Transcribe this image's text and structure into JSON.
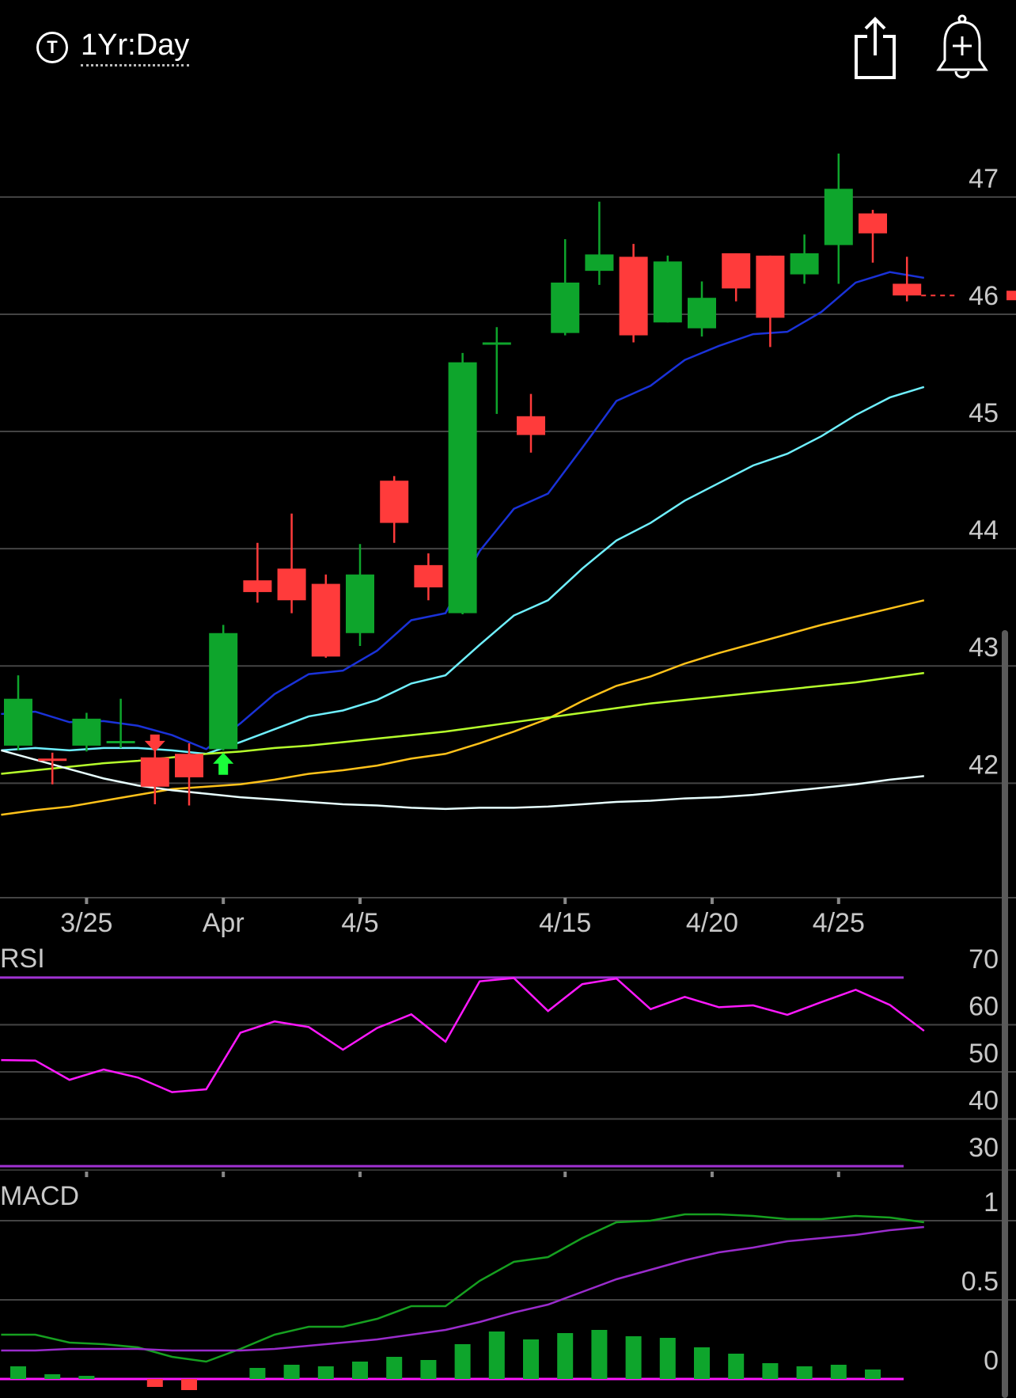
{
  "header": {
    "timeframe_icon": "T",
    "timeframe_label": "1Yr:Day",
    "share_icon": "share-icon",
    "alert_icon": "add-alert-bell-icon"
  },
  "colors": {
    "up": "#0ea52c",
    "down": "#ff3b3b",
    "ema_blue": "#1a32d8",
    "ema_cyan": "#6ff0ff",
    "ma_orange": "#ffc21a",
    "ma_lime": "#b6ff2c",
    "ma_white": "#e8ffff",
    "rsi_line": "#ff19ff",
    "rsi_band": "#a032d2",
    "macd_line": "#16a020",
    "signal_line": "#9a2ccc",
    "hist_pos": "#0ea52c",
    "hist_neg": "#ff3b3b",
    "grid": "#444444",
    "text": "#c8c8c8"
  },
  "chart_data": [
    {
      "type": "candlestick",
      "panel": "price",
      "x_labels": [
        {
          "label": "3/25",
          "index": 2
        },
        {
          "label": "Apr",
          "index": 6
        },
        {
          "label": "4/5",
          "index": 10
        },
        {
          "label": "4/15",
          "index": 16
        },
        {
          "label": "4/20",
          "index": 20.3
        },
        {
          "label": "4/25",
          "index": 24
        }
      ],
      "y_ticks": [
        42,
        43,
        44,
        45,
        46,
        47
      ],
      "ylim": [
        41.05,
        47.6
      ],
      "candles": [
        {
          "o": 42.32,
          "h": 42.92,
          "l": 42.28,
          "c": 42.72
        },
        {
          "o": 42.2,
          "h": 42.26,
          "l": 41.99,
          "c": 42.18
        },
        {
          "o": 42.32,
          "h": 42.6,
          "l": 42.27,
          "c": 42.55
        },
        {
          "o": 42.35,
          "h": 42.72,
          "l": 42.3,
          "c": 42.35
        },
        {
          "o": 42.22,
          "h": 42.38,
          "l": 41.82,
          "c": 41.97
        },
        {
          "o": 42.25,
          "h": 42.34,
          "l": 41.81,
          "c": 42.05
        },
        {
          "o": 42.29,
          "h": 43.35,
          "l": 42.28,
          "c": 43.28
        },
        {
          "o": 43.73,
          "h": 44.05,
          "l": 43.54,
          "c": 43.63
        },
        {
          "o": 43.83,
          "h": 44.3,
          "l": 43.45,
          "c": 43.56
        },
        {
          "o": 43.7,
          "h": 43.78,
          "l": 43.07,
          "c": 43.08
        },
        {
          "o": 43.28,
          "h": 44.04,
          "l": 43.17,
          "c": 43.78
        },
        {
          "o": 44.58,
          "h": 44.62,
          "l": 44.05,
          "c": 44.22
        },
        {
          "o": 43.86,
          "h": 43.96,
          "l": 43.56,
          "c": 43.67
        },
        {
          "o": 43.45,
          "h": 45.67,
          "l": 43.44,
          "c": 45.59
        },
        {
          "o": 45.75,
          "h": 45.89,
          "l": 45.15,
          "c": 45.75
        },
        {
          "o": 45.13,
          "h": 45.32,
          "l": 44.82,
          "c": 44.97
        },
        {
          "o": 45.84,
          "h": 46.64,
          "l": 45.82,
          "c": 46.27
        },
        {
          "o": 46.37,
          "h": 46.96,
          "l": 46.25,
          "c": 46.51
        },
        {
          "o": 46.49,
          "h": 46.6,
          "l": 45.76,
          "c": 45.82
        },
        {
          "o": 45.93,
          "h": 46.5,
          "l": 45.93,
          "c": 46.45
        },
        {
          "o": 45.88,
          "h": 46.28,
          "l": 45.81,
          "c": 46.14
        },
        {
          "o": 46.52,
          "h": 46.52,
          "l": 46.11,
          "c": 46.22
        },
        {
          "o": 46.5,
          "h": 46.5,
          "l": 45.72,
          "c": 45.97
        },
        {
          "o": 46.34,
          "h": 46.68,
          "l": 46.26,
          "c": 46.52
        },
        {
          "o": 46.59,
          "h": 47.37,
          "l": 46.26,
          "c": 47.07
        },
        {
          "o": 46.86,
          "h": 46.89,
          "l": 46.44,
          "c": 46.69
        },
        {
          "o": 46.26,
          "h": 46.49,
          "l": 46.11,
          "c": 46.16
        }
      ],
      "last_price": 46.16,
      "signals": [
        {
          "type": "sell",
          "index": 4,
          "y": 42.28
        },
        {
          "type": "buy",
          "index": 6,
          "y": 42.26
        }
      ],
      "overlays": [
        {
          "key": "ema_blue",
          "start": 0,
          "values": [
            42.59,
            42.61,
            42.52,
            42.53,
            42.49,
            42.41,
            42.29,
            42.51,
            42.76,
            42.93,
            42.96,
            43.13,
            43.39,
            43.45,
            43.98,
            44.34,
            44.47,
            44.86,
            45.26,
            45.39,
            45.61,
            45.73,
            45.83,
            45.85,
            46.02,
            46.27,
            46.36,
            46.31
          ]
        },
        {
          "key": "ema_cyan",
          "start": 0,
          "values": [
            42.28,
            42.3,
            42.28,
            42.3,
            42.3,
            42.28,
            42.25,
            42.35,
            42.46,
            42.57,
            42.62,
            42.71,
            42.85,
            42.92,
            43.18,
            43.43,
            43.56,
            43.83,
            44.07,
            44.22,
            44.41,
            44.56,
            44.71,
            44.81,
            44.96,
            45.14,
            45.29,
            45.38
          ]
        },
        {
          "key": "ma_orange",
          "start": 0,
          "values": [
            41.73,
            41.77,
            41.8,
            41.85,
            41.9,
            41.95,
            41.97,
            41.99,
            42.03,
            42.08,
            42.11,
            42.15,
            42.21,
            42.25,
            42.34,
            42.44,
            42.55,
            42.7,
            42.83,
            42.91,
            43.02,
            43.11,
            43.19,
            43.27,
            43.35,
            43.42,
            43.49,
            43.56
          ]
        },
        {
          "key": "ma_lime",
          "start": 0,
          "values": [
            42.08,
            42.11,
            42.14,
            42.17,
            42.19,
            42.22,
            42.25,
            42.27,
            42.3,
            42.32,
            42.35,
            42.38,
            42.41,
            42.44,
            42.48,
            42.52,
            42.56,
            42.6,
            42.64,
            42.68,
            42.71,
            42.74,
            42.77,
            42.8,
            42.83,
            42.86,
            42.9,
            42.94
          ]
        },
        {
          "key": "ma_white",
          "start": 0,
          "values": [
            42.28,
            42.2,
            42.12,
            42.04,
            41.98,
            41.94,
            41.91,
            41.88,
            41.86,
            41.84,
            41.82,
            41.81,
            41.79,
            41.78,
            41.79,
            41.79,
            41.8,
            41.82,
            41.84,
            41.85,
            41.87,
            41.88,
            41.9,
            41.93,
            41.96,
            41.99,
            42.03,
            42.06
          ]
        }
      ]
    },
    {
      "type": "line",
      "panel": "rsi",
      "title": "RSI",
      "y_ticks": [
        30,
        40,
        50,
        60,
        70
      ],
      "ylim": [
        27.5,
        72.5
      ],
      "bands": [
        30,
        70
      ],
      "series": [
        {
          "key": "rsi_line",
          "start": -0.5,
          "values": [
            52.5,
            52.4,
            48.3,
            50.5,
            48.8,
            45.7,
            46.3,
            58.3,
            60.7,
            59.5,
            54.7,
            59.3,
            62.2,
            56.4,
            69.2,
            69.9,
            62.9,
            68.6,
            69.8,
            63.3,
            65.9,
            63.7,
            64.1,
            62.1,
            64.8,
            67.4,
            64.2,
            58.7
          ]
        }
      ]
    },
    {
      "type": "line",
      "panel": "macd",
      "title": "MACD",
      "y_ticks": [
        0,
        0.5,
        1
      ],
      "ylim": [
        -0.12,
        1.24
      ],
      "series": [
        {
          "key": "macd_line",
          "start": -0.5,
          "values": [
            0.28,
            0.28,
            0.23,
            0.22,
            0.2,
            0.14,
            0.11,
            0.19,
            0.28,
            0.33,
            0.33,
            0.38,
            0.46,
            0.46,
            0.62,
            0.74,
            0.77,
            0.89,
            0.99,
            1.0,
            1.04,
            1.04,
            1.03,
            1.01,
            1.01,
            1.03,
            1.02,
            0.99
          ]
        },
        {
          "key": "signal_line",
          "start": -0.5,
          "values": [
            0.18,
            0.18,
            0.19,
            0.19,
            0.19,
            0.18,
            0.18,
            0.18,
            0.19,
            0.21,
            0.23,
            0.25,
            0.28,
            0.31,
            0.36,
            0.42,
            0.47,
            0.55,
            0.63,
            0.69,
            0.75,
            0.8,
            0.83,
            0.87,
            0.89,
            0.91,
            0.94,
            0.96
          ]
        }
      ],
      "histogram": [
        0.08,
        0.03,
        0.02,
        0,
        -0.05,
        -0.07,
        0,
        0.07,
        0.09,
        0.08,
        0.11,
        0.14,
        0.12,
        0.22,
        0.3,
        0.25,
        0.29,
        0.31,
        0.27,
        0.26,
        0.2,
        0.16,
        0.1,
        0.08,
        0.09,
        0.06,
        0
      ]
    }
  ]
}
